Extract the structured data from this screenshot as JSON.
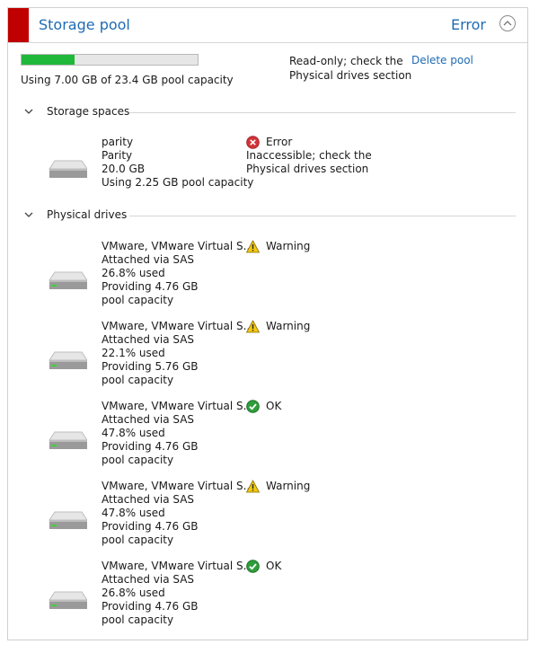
{
  "header": {
    "title": "Storage pool",
    "status": "Error",
    "status_color": "#c00000",
    "link_color": "#1f6bb3"
  },
  "summary": {
    "capacity_text": "Using 7.00 GB of 23.4 GB pool capacity",
    "usage_fraction": 0.3,
    "bar_color": "#1fb83a",
    "readonly_text": "Read-only; check the Physical drives section",
    "delete_label": "Delete pool"
  },
  "storage_spaces": {
    "heading": "Storage spaces",
    "items": [
      {
        "name": "parity",
        "resiliency": "Parity",
        "size": "20.0 GB",
        "usage": "Using 2.25 GB pool capacity",
        "health": "Error",
        "health_icon": "error-icon",
        "health_detail": "Inaccessible; check the Physical drives section"
      }
    ]
  },
  "physical_drives": {
    "heading": "Physical drives",
    "items": [
      {
        "name": "VMware, VMware Virtual S...",
        "connection": "Attached via SAS",
        "used": "26.8% used",
        "providing": "Providing 4.76 GB pool capacity",
        "health": "Warning",
        "health_icon": "warning-icon"
      },
      {
        "name": "VMware, VMware Virtual S...",
        "connection": "Attached via SAS",
        "used": "22.1% used",
        "providing": "Providing 5.76 GB pool capacity",
        "health": "Warning",
        "health_icon": "warning-icon"
      },
      {
        "name": "VMware, VMware Virtual S...",
        "connection": "Attached via SAS",
        "used": "47.8% used",
        "providing": "Providing 4.76 GB pool capacity",
        "health": "OK",
        "health_icon": "ok-icon"
      },
      {
        "name": "VMware, VMware Virtual S...",
        "connection": "Attached via SAS",
        "used": "47.8% used",
        "providing": "Providing 4.76 GB pool capacity",
        "health": "Warning",
        "health_icon": "warning-icon"
      },
      {
        "name": "VMware, VMware Virtual S...",
        "connection": "Attached via SAS",
        "used": "26.8% used",
        "providing": "Providing 4.76 GB pool capacity",
        "health": "OK",
        "health_icon": "ok-icon"
      }
    ]
  }
}
